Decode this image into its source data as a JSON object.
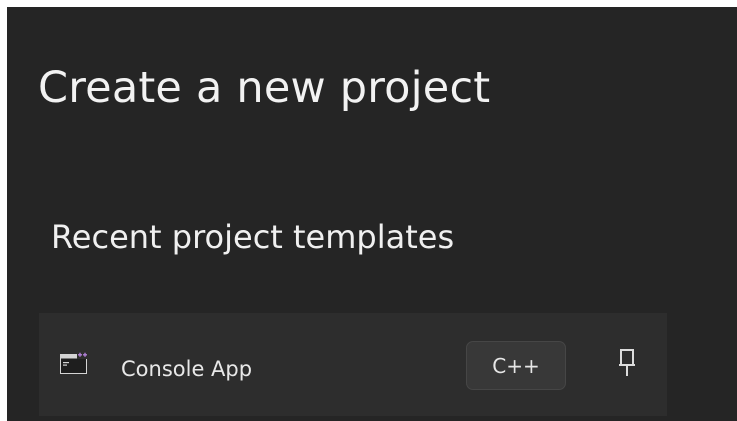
{
  "page": {
    "title": "Create a new project"
  },
  "recent_templates": {
    "heading": "Recent project templates",
    "items": [
      {
        "name": "Console App",
        "language": "C++",
        "icon": "console-app-icon",
        "pin_icon": "pin-icon"
      }
    ]
  },
  "colors": {
    "background": "#252525",
    "row_background": "#2d2d2d",
    "badge_background": "#383838",
    "text": "#f2f2f2",
    "icon_accent": "#b180d7"
  }
}
